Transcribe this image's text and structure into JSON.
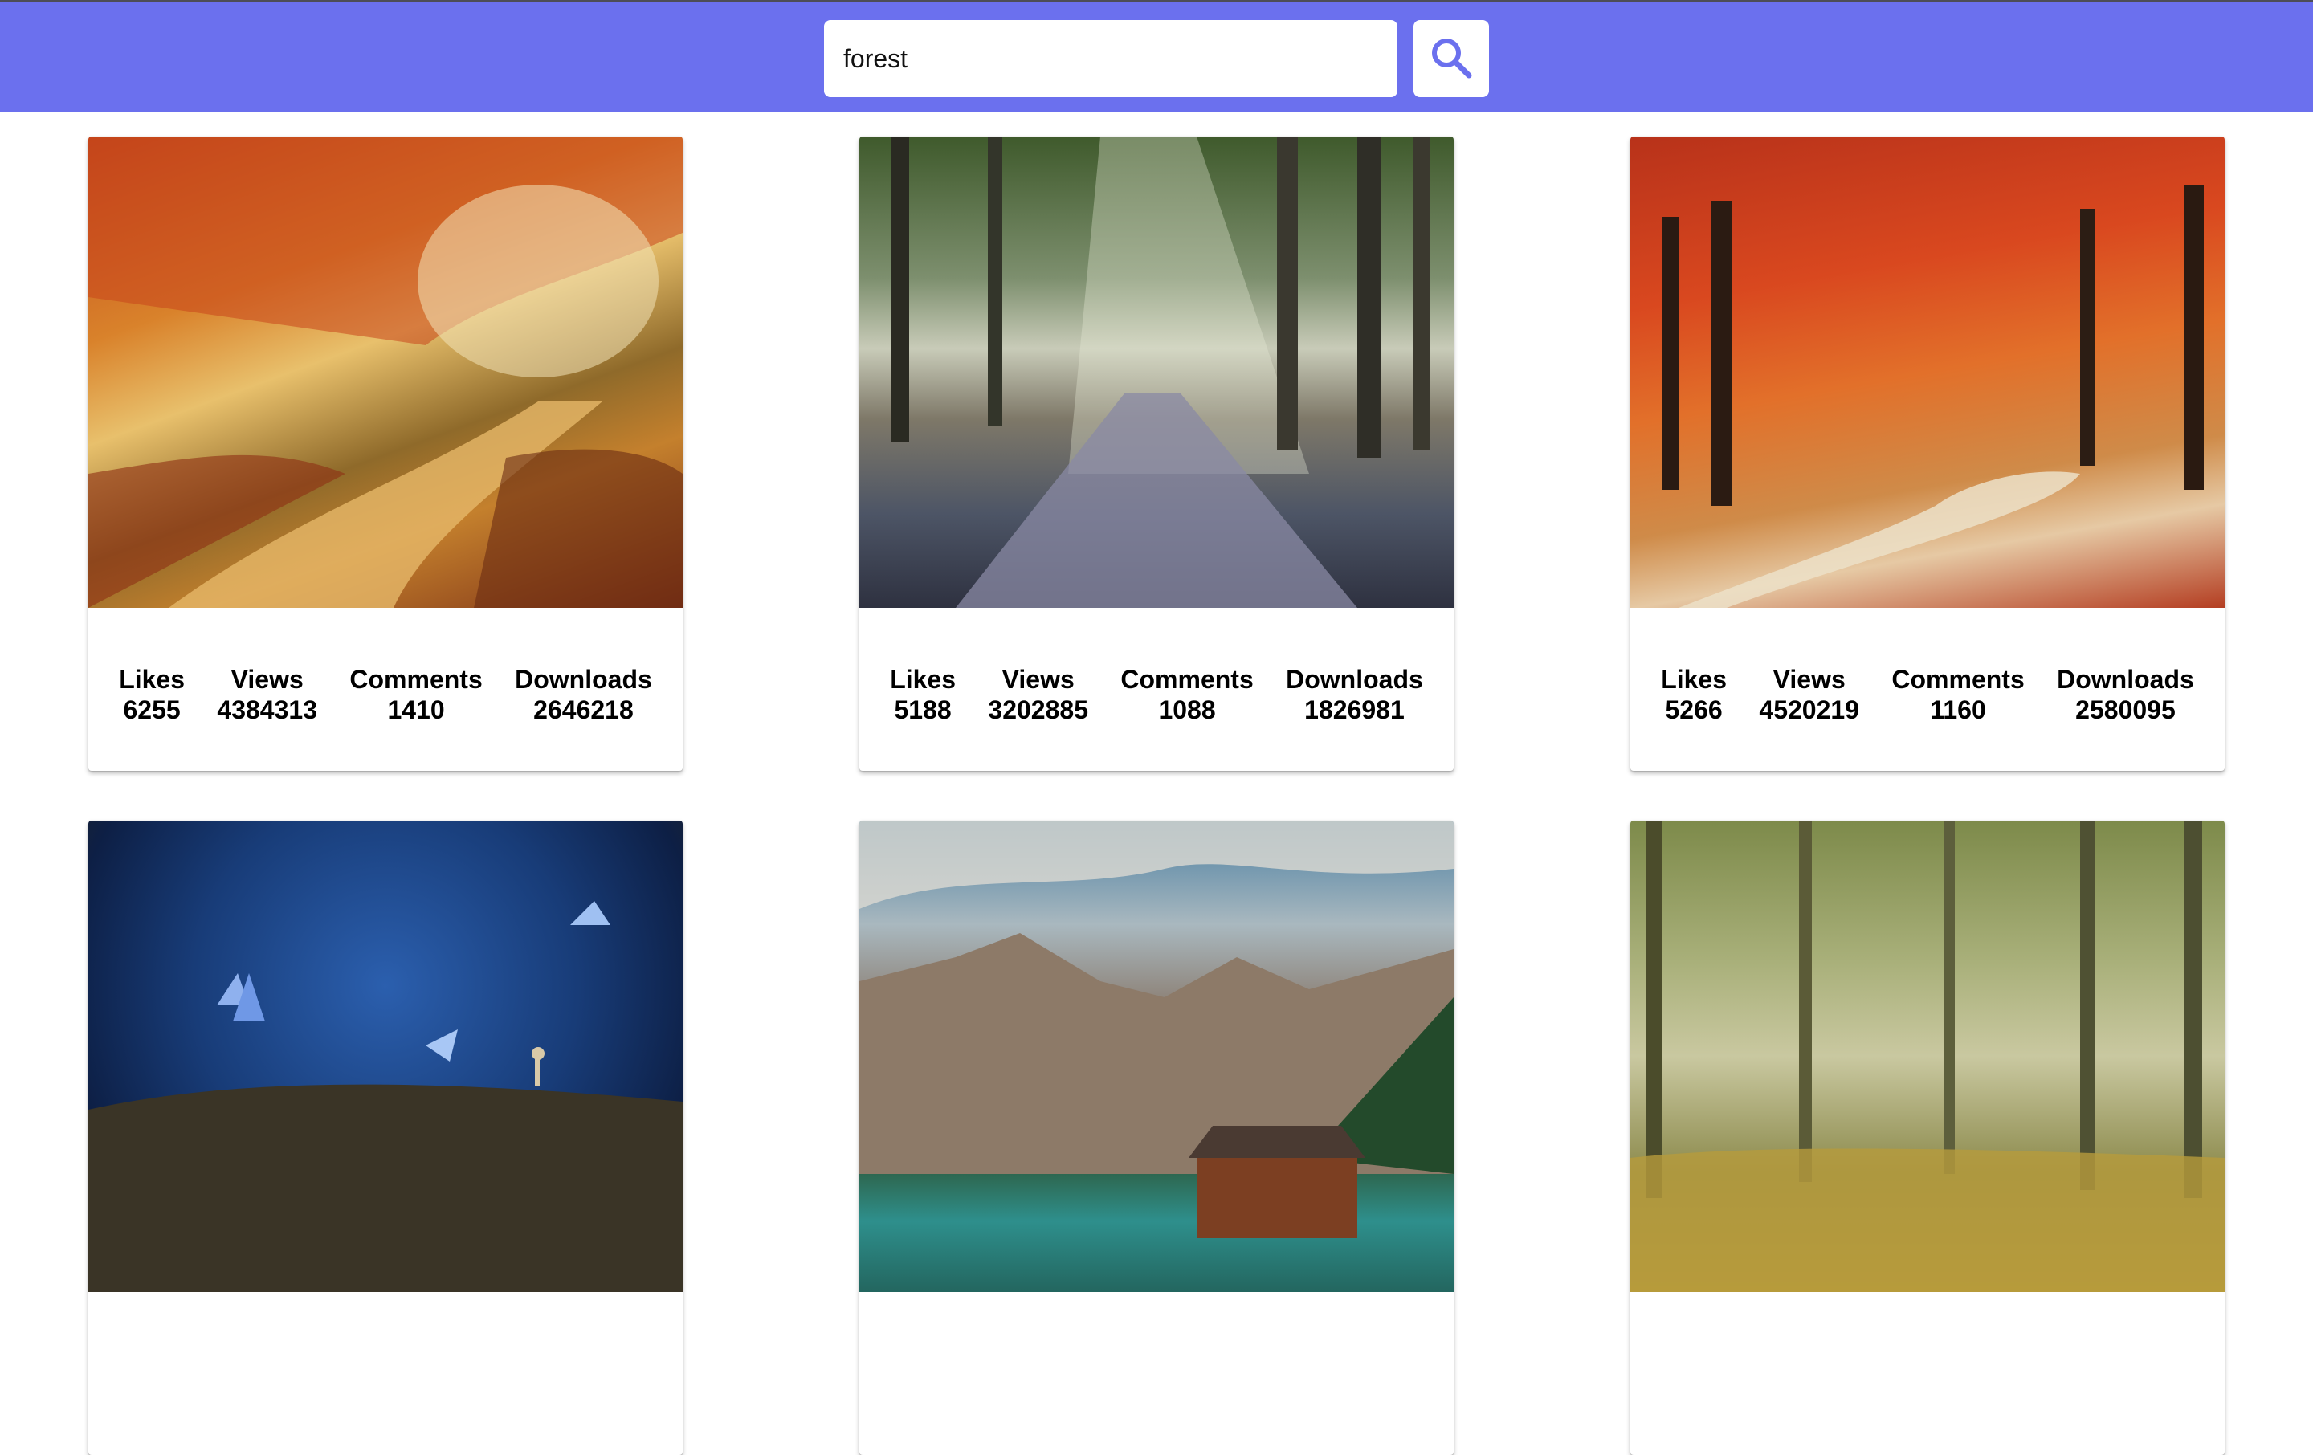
{
  "search": {
    "value": "forest",
    "icon": "search-icon"
  },
  "colors": {
    "header_background": "#6b70ee",
    "search_icon": "#6b70ee"
  },
  "stat_labels": {
    "likes": "Likes",
    "views": "Views",
    "comments": "Comments",
    "downloads": "Downloads"
  },
  "cards": [
    {
      "image": "autumn-forest-road",
      "likes": "6255",
      "views": "4384313",
      "comments": "1410",
      "downloads": "2646218"
    },
    {
      "image": "sunlit-forest-path",
      "likes": "5188",
      "views": "3202885",
      "comments": "1088",
      "downloads": "1826981"
    },
    {
      "image": "red-autumn-forest",
      "likes": "5266",
      "views": "4520219",
      "comments": "1160",
      "downloads": "2580095"
    },
    {
      "image": "blue-butterflies-forest"
    },
    {
      "image": "mountain-lake-cabin"
    },
    {
      "image": "green-tree-forest"
    }
  ]
}
